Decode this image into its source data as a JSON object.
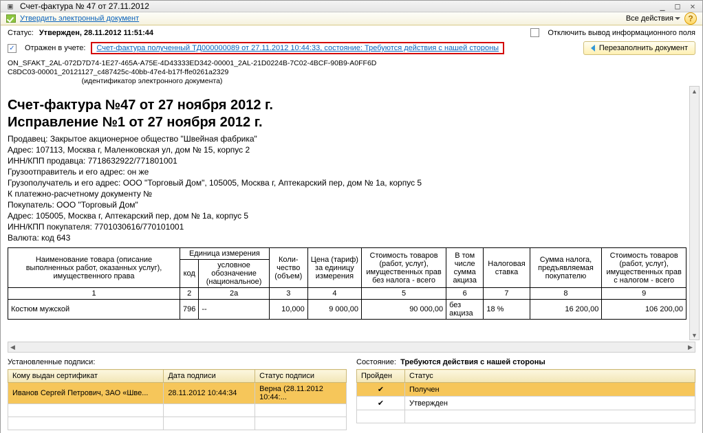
{
  "window": {
    "title": "Счет-фактура № 47 от 27.11.2012"
  },
  "toolbar": {
    "approve": "Утвердить электронный документ",
    "all_actions": "Все действия"
  },
  "status": {
    "label": "Статус:",
    "value": "Утвержден, 28.11.2012 11:51:44",
    "toggle_info": "Отключить вывод информационного поля"
  },
  "reflect": {
    "label": "Отражен в учете:",
    "link": "Счет-фактура полученный ТД000000089 от 27.11.2012 10:44:33, состояние: Требуются действия с нашей стороны",
    "refill_button": "Перезаполнить документ"
  },
  "doc_id_lines": [
    "ON_SFAKT_2AL-072D7D74-1E27-465A-A75E-4D43333ED342-00001_2AL-21D0224B-7C02-4BCF-90B9-A0FF6D",
    "C8DC03-00001_20121127_c487425c-40bb-47e4-b17f-ffe0261a2329"
  ],
  "doc_id_label": "(идентификатор электронного документа)",
  "doc": {
    "title": "Счет-фактура №47 от 27 ноября 2012 г.",
    "subtitle": "Исправление №1 от 27 ноября 2012 г.",
    "meta": [
      "Продавец: Закрытое акционерное общество \"Швейная фабрика\"",
      "Адрес: 107113, Москва г, Маленковская ул, дом № 15, корпус 2",
      "ИНН/КПП продавца: 7718632922/771801001",
      "Грузоотправитель и его адрес: он же",
      "Грузополучатель и его адрес: ООО \"Торговый Дом\", 105005, Москва г, Аптекарский пер, дом № 1а, корпус 5",
      "К платежно-расчетному документу №",
      "Покупатель: ООО \"Торговый Дом\"",
      "Адрес: 105005, Москва г, Аптекарский пер, дом № 1а, корпус 5",
      "ИНН/КПП покупателя: 7701030616/770101001",
      "Валюта: код 643"
    ],
    "headers": {
      "name": "Наименование товара (описание выполненных работ, оказанных услуг), имущественного права",
      "unit": "Единица измерения",
      "unit_code": "код",
      "unit_name": "условное обозначение (национальное)",
      "qty": "Коли-чество (объем)",
      "price": "Цена (тариф) за единицу измерения",
      "cost_no_tax": "Стоимость товаров (работ, услуг), имущественных прав без налога - всего",
      "excise": "В том числе сумма акциза",
      "tax_rate": "Налоговая ставка",
      "tax_amount": "Сумма налога, предъявляемая покупателю",
      "cost_with_tax": "Стоимость товаров (работ, услуг), имущественных прав с налогом - всего"
    },
    "col_nums": [
      "1",
      "2",
      "2а",
      "3",
      "4",
      "5",
      "6",
      "7",
      "8",
      "9"
    ],
    "rows": [
      {
        "name": "Костюм мужской",
        "code": "796",
        "uname": "--",
        "qty": "10,000",
        "price": "9 000,00",
        "cost_no_tax": "90 000,00",
        "excise": "без акциза",
        "tax_rate": "18 %",
        "tax": "16 200,00",
        "cost_with_tax": "106 200,00"
      }
    ]
  },
  "signatures": {
    "title": "Установленные подписи:",
    "headers": {
      "who": "Кому выдан сертификат",
      "date": "Дата подписи",
      "status": "Статус подписи"
    },
    "rows": [
      {
        "who": "Иванов Сергей Петрович, ЗАО «Шве...",
        "date": "28.11.2012 10:44:34",
        "status": "Верна (28.11.2012 10:44:..."
      }
    ]
  },
  "state": {
    "label": "Состояние:",
    "value": "Требуются действия с нашей стороны",
    "headers": {
      "passed": "Пройден",
      "status": "Статус"
    },
    "rows": [
      {
        "passed": "✔",
        "status": "Получен"
      },
      {
        "passed": "✔",
        "status": "Утвержден"
      }
    ]
  }
}
